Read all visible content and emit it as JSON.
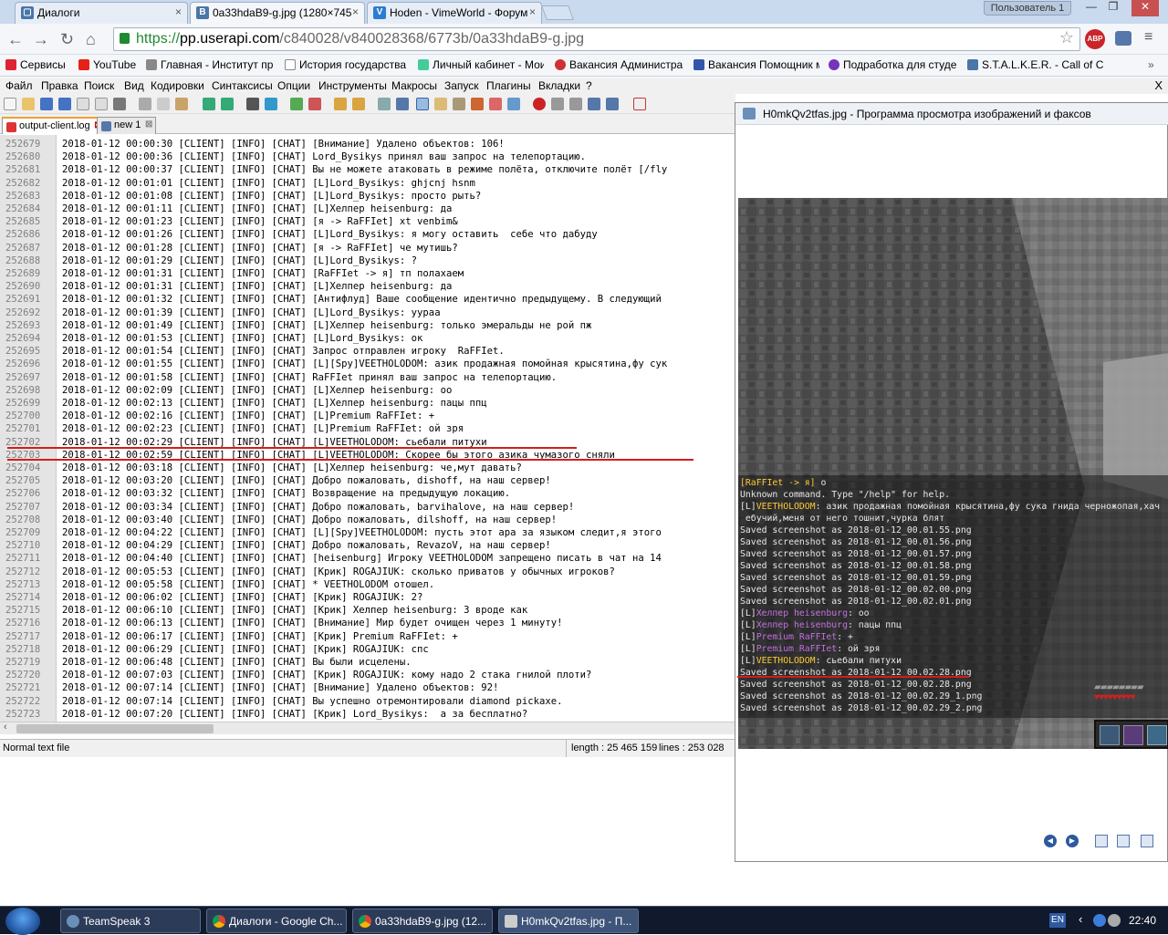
{
  "browser": {
    "tabs": [
      {
        "label": "Диалоги",
        "icon": "vk-icon"
      },
      {
        "label": "0a33hdaB9-g.jpg (1280×745",
        "icon": "vk-icon"
      },
      {
        "label": "Hoden - VimeWorld - Форум",
        "icon": "vimeworld-icon"
      }
    ],
    "profile": "Пользователь 1",
    "address": {
      "scheme": "https://",
      "host": "pp.userapi.com",
      "path": "/c840028/v840028368/6773b/0a33hdaB9-g.jpg"
    },
    "abp": "ABP",
    "bookmarks": [
      "Сервисы",
      "YouTube",
      "Главная - Институт пр",
      "История государства и",
      "Личный кабинет - Мои",
      "Вакансия Администрат",
      "Вакансия Помощник ме",
      "Подработка для студе",
      "S.T.A.L.K.E.R. - Call of C"
    ]
  },
  "npp": {
    "menu": [
      "Файл",
      "Правка",
      "Поиск",
      "Вид",
      "Кодировки",
      "Синтаксисы",
      "Опции",
      "Инструменты",
      "Макросы",
      "Запуск",
      "Плагины",
      "Вкладки",
      "?"
    ],
    "close": "X",
    "tabs": [
      "output-client.log",
      "new 1"
    ],
    "lines": [
      {
        "n": "252679",
        "t": "2018-01-12 00:00:30 [CLIENT] [INFO] [CHAT] [Внимание] Удалено объектов: 106!"
      },
      {
        "n": "252680",
        "t": "2018-01-12 00:00:36 [CLIENT] [INFO] [CHAT] Lord_Bysikys принял ваш запрос на телепортацию."
      },
      {
        "n": "252681",
        "t": "2018-01-12 00:00:37 [CLIENT] [INFO] [CHAT] Вы не можете атаковать в режиме полёта, отключите полёт [/fly"
      },
      {
        "n": "252682",
        "t": "2018-01-12 00:01:01 [CLIENT] [INFO] [CHAT] [L]Lord_Bysikys: ghjcnj hsnm"
      },
      {
        "n": "252683",
        "t": "2018-01-12 00:01:08 [CLIENT] [INFO] [CHAT] [L]Lord_Bysikys: просто рыть?"
      },
      {
        "n": "252684",
        "t": "2018-01-12 00:01:11 [CLIENT] [INFO] [CHAT] [L]Хелпер heisenburg: да"
      },
      {
        "n": "252685",
        "t": "2018-01-12 00:01:23 [CLIENT] [INFO] [CHAT] [я -> RaFFIet] xt venbim&"
      },
      {
        "n": "252686",
        "t": "2018-01-12 00:01:26 [CLIENT] [INFO] [CHAT] [L]Lord_Bysikys: я могу оставить  себе что дабуду"
      },
      {
        "n": "252687",
        "t": "2018-01-12 00:01:28 [CLIENT] [INFO] [CHAT] [я -> RaFFIet] че мутишь?"
      },
      {
        "n": "252688",
        "t": "2018-01-12 00:01:29 [CLIENT] [INFO] [CHAT] [L]Lord_Bysikys: ?"
      },
      {
        "n": "252689",
        "t": "2018-01-12 00:01:31 [CLIENT] [INFO] [CHAT] [RaFFIet -> я] тп полахаем"
      },
      {
        "n": "252690",
        "t": "2018-01-12 00:01:31 [CLIENT] [INFO] [CHAT] [L]Хелпер heisenburg: да"
      },
      {
        "n": "252691",
        "t": "2018-01-12 00:01:32 [CLIENT] [INFO] [CHAT] [Антифлуд] Ваше сообщение идентично предыдущему. В следующий"
      },
      {
        "n": "252692",
        "t": "2018-01-12 00:01:39 [CLIENT] [INFO] [CHAT] [L]Lord_Bysikys: уураа"
      },
      {
        "n": "252693",
        "t": "2018-01-12 00:01:49 [CLIENT] [INFO] [CHAT] [L]Хелпер heisenburg: только эмеральды не рой пж"
      },
      {
        "n": "252694",
        "t": "2018-01-12 00:01:53 [CLIENT] [INFO] [CHAT] [L]Lord_Bysikys: ок"
      },
      {
        "n": "252695",
        "t": "2018-01-12 00:01:54 [CLIENT] [INFO] [CHAT] Запрос отправлен игроку  RaFFIet."
      },
      {
        "n": "252696",
        "t": "2018-01-12 00:01:55 [CLIENT] [INFO] [CHAT] [L][Spy]VEETHOLODOM: азик продажная помойная крысятина,фу сук"
      },
      {
        "n": "252697",
        "t": "2018-01-12 00:01:58 [CLIENT] [INFO] [CHAT] RaFFIet принял ваш запрос на телепортацию."
      },
      {
        "n": "252698",
        "t": "2018-01-12 00:02:09 [CLIENT] [INFO] [CHAT] [L]Хелпер heisenburg: оо"
      },
      {
        "n": "252699",
        "t": "2018-01-12 00:02:13 [CLIENT] [INFO] [CHAT] [L]Хелпер heisenburg: пацы ппц"
      },
      {
        "n": "252700",
        "t": "2018-01-12 00:02:16 [CLIENT] [INFO] [CHAT] [L]Premium RaFFIet: +"
      },
      {
        "n": "252701",
        "t": "2018-01-12 00:02:23 [CLIENT] [INFO] [CHAT] [L]Premium RaFFIet: ой зря"
      },
      {
        "n": "252702",
        "t": "2018-01-12 00:02:29 [CLIENT] [INFO] [CHAT] [L]VEETHOLODOM: сьебали питухи"
      },
      {
        "n": "252703",
        "t": "2018-01-12 00:02:59 [CLIENT] [INFO] [CHAT] [L]VEETHOLODOM: Скорее бы этого азика чумазого сняли"
      },
      {
        "n": "252704",
        "t": "2018-01-12 00:03:18 [CLIENT] [INFO] [CHAT] [L]Хелпер heisenburg: че,мут давать?"
      },
      {
        "n": "252705",
        "t": "2018-01-12 00:03:20 [CLIENT] [INFO] [CHAT] Добро пожаловать, dishoff, на наш сервер!"
      },
      {
        "n": "252706",
        "t": "2018-01-12 00:03:32 [CLIENT] [INFO] [CHAT] Возвращение на предыдущую локацию."
      },
      {
        "n": "252707",
        "t": "2018-01-12 00:03:34 [CLIENT] [INFO] [CHAT] Добро пожаловать, barvihalove, на наш сервер!"
      },
      {
        "n": "252708",
        "t": "2018-01-12 00:03:40 [CLIENT] [INFO] [CHAT] Добро пожаловать, dilshoff, на наш сервер!"
      },
      {
        "n": "252709",
        "t": "2018-01-12 00:04:22 [CLIENT] [INFO] [CHAT] [L][Spy]VEETHOLODOM: пусть этот ара за языком следит,я этого"
      },
      {
        "n": "252710",
        "t": "2018-01-12 00:04:29 [CLIENT] [INFO] [CHAT] Добро пожаловать, RevazoV, на наш сервер!"
      },
      {
        "n": "252711",
        "t": "2018-01-12 00:04:40 [CLIENT] [INFO] [CHAT] [heisenburg] Игроку VEETHOLODOM запрещено писать в чат на 14"
      },
      {
        "n": "252712",
        "t": "2018-01-12 00:05:53 [CLIENT] [INFO] [CHAT] [Крик] ROGAJIUK: сколько приватов у обычных игроков?"
      },
      {
        "n": "252713",
        "t": "2018-01-12 00:05:58 [CLIENT] [INFO] [CHAT] * VEETHOLODOM отошел."
      },
      {
        "n": "252714",
        "t": "2018-01-12 00:06:02 [CLIENT] [INFO] [CHAT] [Крик] ROGAJIUK: 2?"
      },
      {
        "n": "252715",
        "t": "2018-01-12 00:06:10 [CLIENT] [INFO] [CHAT] [Крик] Хелпер heisenburg: 3 вроде как"
      },
      {
        "n": "252716",
        "t": "2018-01-12 00:06:13 [CLIENT] [INFO] [CHAT] [Внимание] Мир будет очищен через 1 минуту!"
      },
      {
        "n": "252717",
        "t": "2018-01-12 00:06:17 [CLIENT] [INFO] [CHAT] [Крик] Premium RaFFIet: +"
      },
      {
        "n": "252718",
        "t": "2018-01-12 00:06:29 [CLIENT] [INFO] [CHAT] [Крик] ROGAJIUK: спс"
      },
      {
        "n": "252719",
        "t": "2018-01-12 00:06:48 [CLIENT] [INFO] [CHAT] Вы были исцелены."
      },
      {
        "n": "252720",
        "t": "2018-01-12 00:07:03 [CLIENT] [INFO] [CHAT] [Крик] ROGAJIUK: кому надо 2 стака гнилой плоти?"
      },
      {
        "n": "252721",
        "t": "2018-01-12 00:07:14 [CLIENT] [INFO] [CHAT] [Внимание] Удалено объектов: 92!"
      },
      {
        "n": "252722",
        "t": "2018-01-12 00:07:14 [CLIENT] [INFO] [CHAT] Вы успешно отремонтировали diamond pickaxe."
      },
      {
        "n": "252723",
        "t": "2018-01-12 00:07:20 [CLIENT] [INFO] [CHAT] [Крик] Lord_Bysikys:  а за бесплатно?"
      }
    ],
    "status": {
      "filetype": "Normal text file",
      "length": "length : 25 465 159",
      "lines": "lines : 253 028"
    }
  },
  "viewer": {
    "title": "H0mkQv2tfas.jpg - Программа просмотра изображений и факсов",
    "chat": [
      {
        "p": "[RaFFIet -> я] ",
        "pc": "pre",
        "t": "о"
      },
      {
        "p": "",
        "pc": "",
        "t": "Unknown command. Type \"/help\" for help."
      },
      {
        "p": "[L]",
        "pc": "",
        "n": "VEETHOLODOM",
        "nc": "pre",
        "t": ": азик продажная помойная крысятина,фу сука гнида черножопая,хач"
      },
      {
        "p": "",
        "pc": "",
        "t": " ебучий,меня от него тошнит,чурка блят"
      },
      {
        "p": "",
        "pc": "",
        "t": "Saved screenshot as 2018-01-12_00.01.55.png"
      },
      {
        "p": "",
        "pc": "",
        "t": "Saved screenshot as 2018-01-12_00.01.56.png"
      },
      {
        "p": "",
        "pc": "",
        "t": "Saved screenshot as 2018-01-12_00.01.57.png"
      },
      {
        "p": "",
        "pc": "",
        "t": "Saved screenshot as 2018-01-12_00.01.58.png"
      },
      {
        "p": "",
        "pc": "",
        "t": "Saved screenshot as 2018-01-12_00.01.59.png"
      },
      {
        "p": "",
        "pc": "",
        "t": "Saved screenshot as 2018-01-12_00.02.00.png"
      },
      {
        "p": "",
        "pc": "",
        "t": "Saved screenshot as 2018-01-12_00.02.01.png"
      },
      {
        "p": "[L]",
        "pc": "",
        "n": "Хелпер heisenburg",
        "nc": "purp",
        "t": ": оо"
      },
      {
        "p": "[L]",
        "pc": "",
        "n": "Хелпер heisenburg",
        "nc": "purp",
        "t": ": пацы ппц"
      },
      {
        "p": "[L]",
        "pc": "",
        "n": "Premium RaFFIet",
        "nc": "purp",
        "t": ": +"
      },
      {
        "p": "[L]",
        "pc": "",
        "n": "Premium RaFFIet",
        "nc": "purp",
        "t": ": ой зря"
      },
      {
        "p": "[L]",
        "pc": "",
        "n": "VEETHOLODOM",
        "nc": "pre",
        "t": ": сьебали питухи"
      },
      {
        "p": "",
        "pc": "",
        "t": "Saved screenshot as 2018-01-12_00.02.28.png"
      },
      {
        "p": "",
        "pc": "",
        "t": "Saved screenshot as 2018-01-12_00.02.28.png"
      },
      {
        "p": "",
        "pc": "",
        "t": "Saved screenshot as 2018-01-12_00.02.29_1.png"
      },
      {
        "p": "",
        "pc": "",
        "t": "Saved screenshot as 2018-01-12_00.02.29_2.png"
      }
    ]
  },
  "taskbar": {
    "tasks": [
      "TeamSpeak 3",
      "Диалоги - Google Ch...",
      "0a33hdaB9-g.jpg (12...",
      "H0mkQv2tfas.jpg - П..."
    ],
    "lang": "EN",
    "clock": "22:40"
  },
  "colors": {
    "highlight": "#d41c1c",
    "vk_blue": "#4a76a8"
  }
}
